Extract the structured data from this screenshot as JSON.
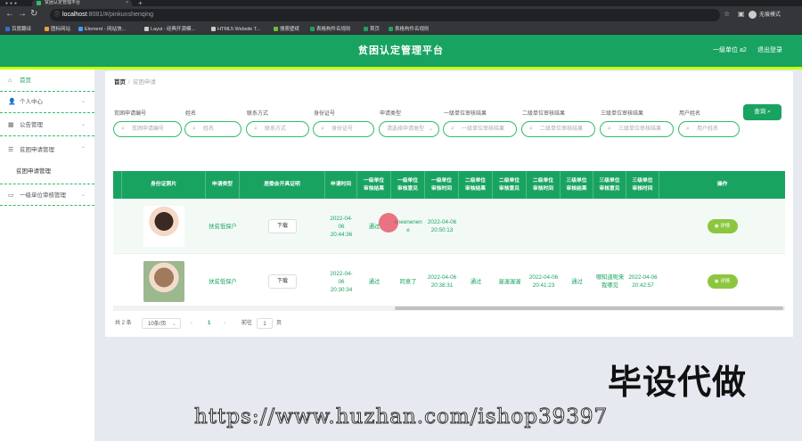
{
  "browser": {
    "tab_title": "贫困认定管理平台",
    "url_host": "localhost",
    "url_path": ":8081/#/pinkunshenqing",
    "profile_label": "无痕模式",
    "bookmarks": [
      "百度翻译",
      "图标网站",
      "Element - 网站快...",
      "Layui - 经典开源模...",
      "HTML5 Website T...",
      "搜索壁纸",
      "表格构件名规则",
      "首页",
      "表格构件名规则"
    ]
  },
  "header": {
    "title": "贫困认定管理平台",
    "user": "一级单位 a2",
    "logout": "退出登录"
  },
  "sidebar": {
    "items": [
      {
        "label": "首页"
      },
      {
        "label": "个人中心"
      },
      {
        "label": "公告管理"
      },
      {
        "label": "贫困申请管理"
      },
      {
        "label": "贫困申请管理"
      },
      {
        "label": "一级单位审核管理"
      }
    ]
  },
  "breadcrumb": {
    "home": "首页",
    "current": "贫困申请"
  },
  "search": {
    "fields": [
      {
        "label": "贫困申请编号",
        "placeholder": "贫困申请编号"
      },
      {
        "label": "姓名",
        "placeholder": "姓名"
      },
      {
        "label": "联系方式",
        "placeholder": "联系方式"
      },
      {
        "label": "身份证号",
        "placeholder": "身份证号"
      },
      {
        "label": "申请类型",
        "placeholder": "请选择申请类型"
      },
      {
        "label": "一级单位审核结果",
        "placeholder": "一级单位审核结果"
      },
      {
        "label": "二级单位审核结果",
        "placeholder": "二级单位审核结果"
      },
      {
        "label": "三级单位审核结果",
        "placeholder": "三级单位审核结果"
      },
      {
        "label": "用户姓名",
        "placeholder": "用户姓名"
      }
    ],
    "button": "查询"
  },
  "table": {
    "headers": [
      "身份证照片",
      "申请类型",
      "居委会开具证明",
      "申请时间",
      "一级单位审核结果",
      "一级单位审核意见",
      "一级单位审核时间",
      "二级单位审核结果",
      "二级单位审核意见",
      "二级单位审核时间",
      "三级单位审核结果",
      "三级单位审核意见",
      "三级单位审核时间",
      "操作"
    ],
    "rows": [
      {
        "photo": "portrait-male",
        "type": "扶贫低保户",
        "download": "下载",
        "apply_time": "2022-04-06 20:44:36",
        "l1_result": "通过",
        "l1_opinion": "eneenenene",
        "l1_time": "2022-04-06 20:50:13",
        "l2_result": "",
        "l2_opinion": "",
        "l2_time": "",
        "l3_result": "",
        "l3_opinion": "",
        "l3_time": "",
        "action": "详情"
      },
      {
        "photo": "portrait-female",
        "type": "扶贫低保户",
        "download": "下载",
        "apply_time": "2022-04-06 20:30:34",
        "l1_result": "通过",
        "l1_opinion": "同意了",
        "l1_time": "2022-04-06 20:38:31",
        "l2_result": "通过",
        "l2_opinion": "渥渥渥渥",
        "l2_time": "2022-04-06 20:41:23",
        "l3_result": "通过",
        "l3_opinion": "哪知道呢来我哪见",
        "l3_time": "2022-04-06 20:42:57",
        "action": "详情"
      }
    ]
  },
  "pagination": {
    "total": "共 2 条",
    "page_size": "10条/页",
    "prev": "‹",
    "current": "1",
    "next": "›",
    "goto_label": "前往",
    "goto_value": "1",
    "page_label": "页"
  },
  "watermark": {
    "text": "毕设代做",
    "url": "https://www.huzhan.com/ishop39397"
  },
  "colors": {
    "accent": "#19a361",
    "highlight": "#c6ff00",
    "detail_button": "#8cc63f"
  }
}
